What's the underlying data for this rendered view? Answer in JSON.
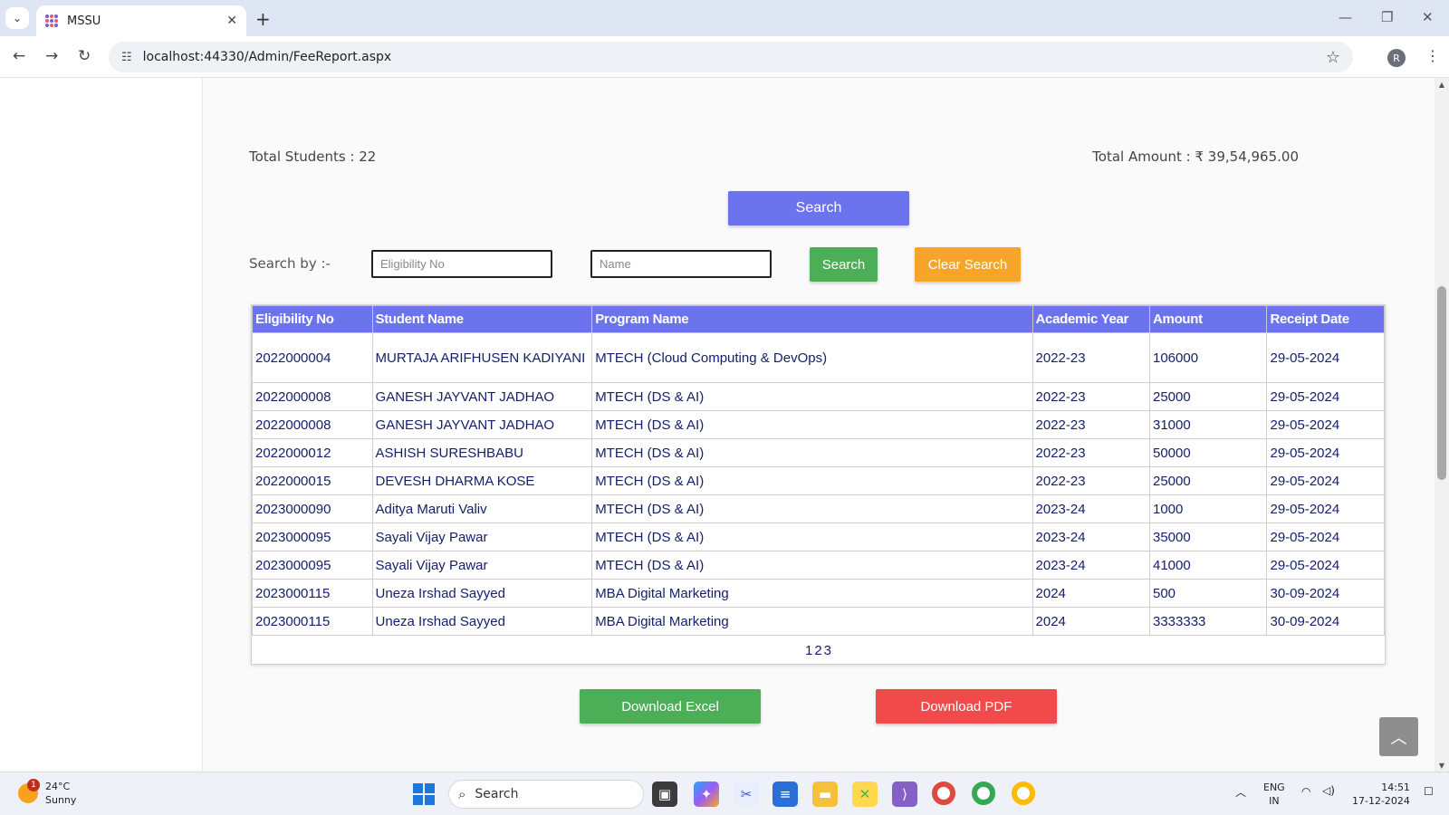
{
  "browser": {
    "tab_title": "MSSU",
    "url": "localhost:44330/Admin/FeeReport.aspx",
    "profile_initial": "R"
  },
  "summary": {
    "total_students": "Total Students : 22",
    "total_amount": "Total Amount : ₹ 39,54,965.00"
  },
  "search": {
    "main_button": "Search",
    "search_by_label": "Search by :-",
    "eligibility_placeholder": "Eligibility No",
    "name_placeholder": "Name",
    "search_button": "Search",
    "clear_button": "Clear Search"
  },
  "table": {
    "headers": [
      "Eligibility No",
      "Student Name",
      "Program Name",
      "Academic Year",
      "Amount",
      "Receipt Date"
    ],
    "rows": [
      [
        "2022000004",
        "MURTAJA ARIFHUSEN KADIYANI",
        "MTECH (Cloud Computing & DevOps)",
        "2022-23",
        "106000",
        "29-05-2024"
      ],
      [
        "2022000008",
        "GANESH JAYVANT JADHAO",
        "MTECH (DS & AI)",
        "2022-23",
        "25000",
        "29-05-2024"
      ],
      [
        "2022000008",
        "GANESH JAYVANT JADHAO",
        "MTECH (DS & AI)",
        "2022-23",
        "31000",
        "29-05-2024"
      ],
      [
        "2022000012",
        "ASHISH SURESHBABU",
        "MTECH (DS & AI)",
        "2022-23",
        "50000",
        "29-05-2024"
      ],
      [
        "2022000015",
        "DEVESH DHARMA KOSE",
        "MTECH (DS & AI)",
        "2022-23",
        "25000",
        "29-05-2024"
      ],
      [
        "2023000090",
        "Aditya Maruti Valiv",
        "MTECH (DS & AI)",
        "2023-24",
        "1000",
        "29-05-2024"
      ],
      [
        "2023000095",
        "Sayali Vijay Pawar",
        "MTECH (DS & AI)",
        "2023-24",
        "35000",
        "29-05-2024"
      ],
      [
        "2023000095",
        "Sayali Vijay Pawar",
        "MTECH (DS & AI)",
        "2023-24",
        "41000",
        "29-05-2024"
      ],
      [
        "2023000115",
        "Uneza Irshad Sayyed",
        "MBA Digital Marketing",
        "2024",
        "500",
        "30-09-2024"
      ],
      [
        "2023000115",
        "Uneza Irshad Sayyed",
        "MBA Digital Marketing",
        "2024",
        "3333333",
        "30-09-2024"
      ]
    ],
    "pages": [
      "1",
      "2",
      "3"
    ]
  },
  "downloads": {
    "excel": "Download Excel",
    "pdf": "Download PDF"
  },
  "colors": {
    "accent": "#6b74ec",
    "success": "#4cae57",
    "warning": "#f7a52a",
    "danger": "#f04a4a",
    "cell_text": "#16206b"
  },
  "taskbar": {
    "weather_badge": "1",
    "temperature": "24°C",
    "condition": "Sunny",
    "search_label": "Search",
    "lang_line1": "ENG",
    "lang_line2": "IN",
    "time": "14:51",
    "date": "17-12-2024"
  }
}
